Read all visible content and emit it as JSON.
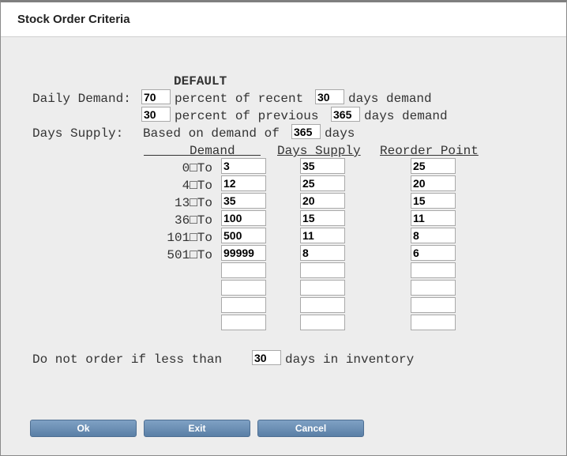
{
  "dialog": {
    "title": "Stock Order Criteria"
  },
  "default_label": "DEFAULT",
  "daily_demand": {
    "label": "Daily Demand:",
    "recent_percent": "70",
    "recent_text": "percent of recent",
    "recent_days": "30",
    "recent_suffix": "days demand",
    "previous_percent": "30",
    "previous_text": "percent of previous",
    "previous_days": "365",
    "previous_suffix": "days demand"
  },
  "days_supply": {
    "label": "Days Supply:",
    "based_text": "Based on demand of",
    "based_days": "365",
    "based_suffix": "days"
  },
  "table": {
    "headers": {
      "demand": "Demand",
      "supply": "Days Supply",
      "reorder": "Reorder Point"
    },
    "rows": [
      {
        "from": "0□To",
        "to": "3",
        "supply": "35",
        "reorder": "25"
      },
      {
        "from": "4□To",
        "to": "12",
        "supply": "25",
        "reorder": "20"
      },
      {
        "from": "13□To",
        "to": "35",
        "supply": "20",
        "reorder": "15"
      },
      {
        "from": "36□To",
        "to": "100",
        "supply": "15",
        "reorder": "11"
      },
      {
        "from": "101□To",
        "to": "500",
        "supply": "11",
        "reorder": "8"
      },
      {
        "from": "501□To",
        "to": "99999",
        "supply": "8",
        "reorder": "6"
      },
      {
        "from": "",
        "to": "",
        "supply": "",
        "reorder": ""
      },
      {
        "from": "",
        "to": "",
        "supply": "",
        "reorder": ""
      },
      {
        "from": "",
        "to": "",
        "supply": "",
        "reorder": ""
      },
      {
        "from": "",
        "to": "",
        "supply": "",
        "reorder": ""
      }
    ]
  },
  "min_inventory": {
    "prefix": "Do not order if less than",
    "days": "30",
    "suffix": "days in inventory"
  },
  "buttons": {
    "ok": "Ok",
    "exit": "Exit",
    "cancel": "Cancel"
  }
}
